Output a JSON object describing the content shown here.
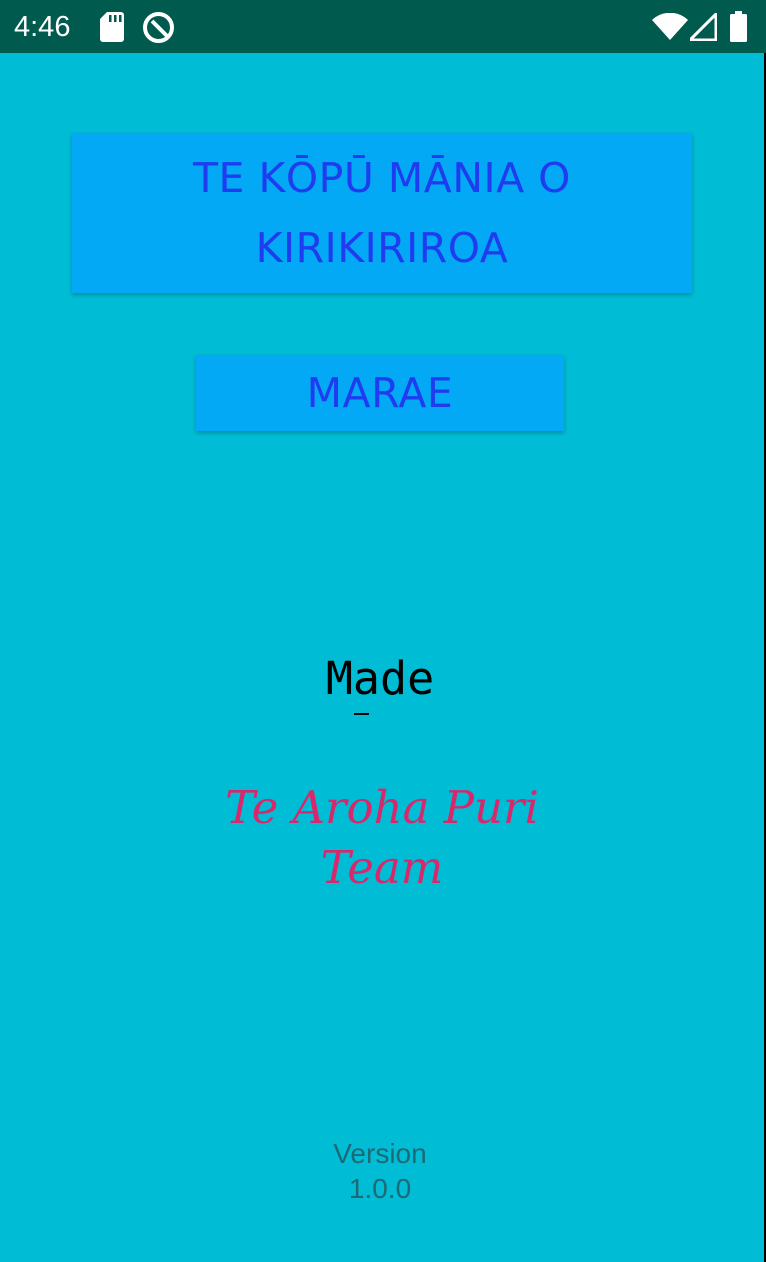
{
  "status_bar": {
    "time": "4:46",
    "icons": [
      "sd-card-icon",
      "q-icon",
      "wifi-icon",
      "signal-icon",
      "battery-icon"
    ]
  },
  "main": {
    "title_button_label": "TE KŌPŪ MĀNIA O KIRIKIRIROA",
    "marae_button_label": "MARAE",
    "made_label": "Made",
    "team_label": "Te Aroha Puri Team",
    "version_label": "Version 1.0.0"
  },
  "colors": {
    "background": "#00BCD4",
    "status_bar": "#005A4D",
    "button_background": "#03A9F4",
    "button_text": "#1F3CF0",
    "team_text": "#D8286B",
    "version_text": "#1C6A74"
  }
}
